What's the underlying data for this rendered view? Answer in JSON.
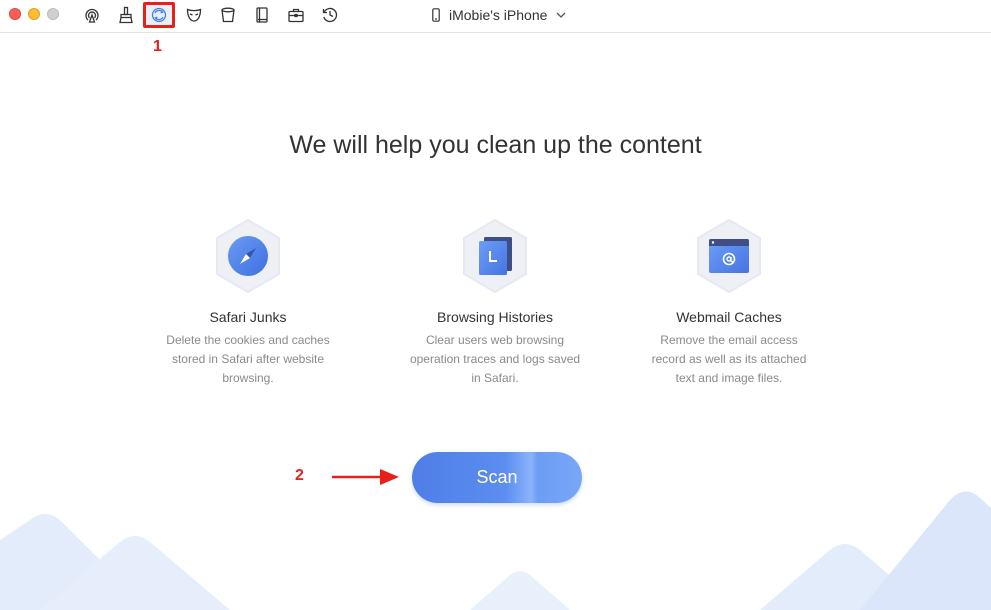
{
  "toolbar": {
    "device_name": "iMobie's iPhone",
    "tools": [
      "airplay-icon",
      "brush-icon",
      "cleanup-icon",
      "mask-icon",
      "trash-bin-icon",
      "book-icon",
      "toolbox-icon",
      "history-clock-icon"
    ],
    "selected_tool": "cleanup-icon"
  },
  "annotations": {
    "step1": "1",
    "step2": "2"
  },
  "main": {
    "headline": "We will help you clean up the content",
    "features": [
      {
        "title": "Safari Junks",
        "description": "Delete the cookies and caches stored in Safari after website browsing.",
        "icon": "compass-icon"
      },
      {
        "title": "Browsing Histories",
        "description": "Clear users web browsing operation traces and logs saved in Safari.",
        "icon": "history-document-icon"
      },
      {
        "title": "Webmail Caches",
        "description": "Remove the email access record as well as its attached text and image files.",
        "icon": "webmail-icon"
      }
    ],
    "scan_label": "Scan"
  },
  "colors": {
    "accent": "#5b8ef0",
    "annotation": "#e8201a",
    "hex_bg": "#eef0f6",
    "mountain": "#dbe8fb"
  }
}
